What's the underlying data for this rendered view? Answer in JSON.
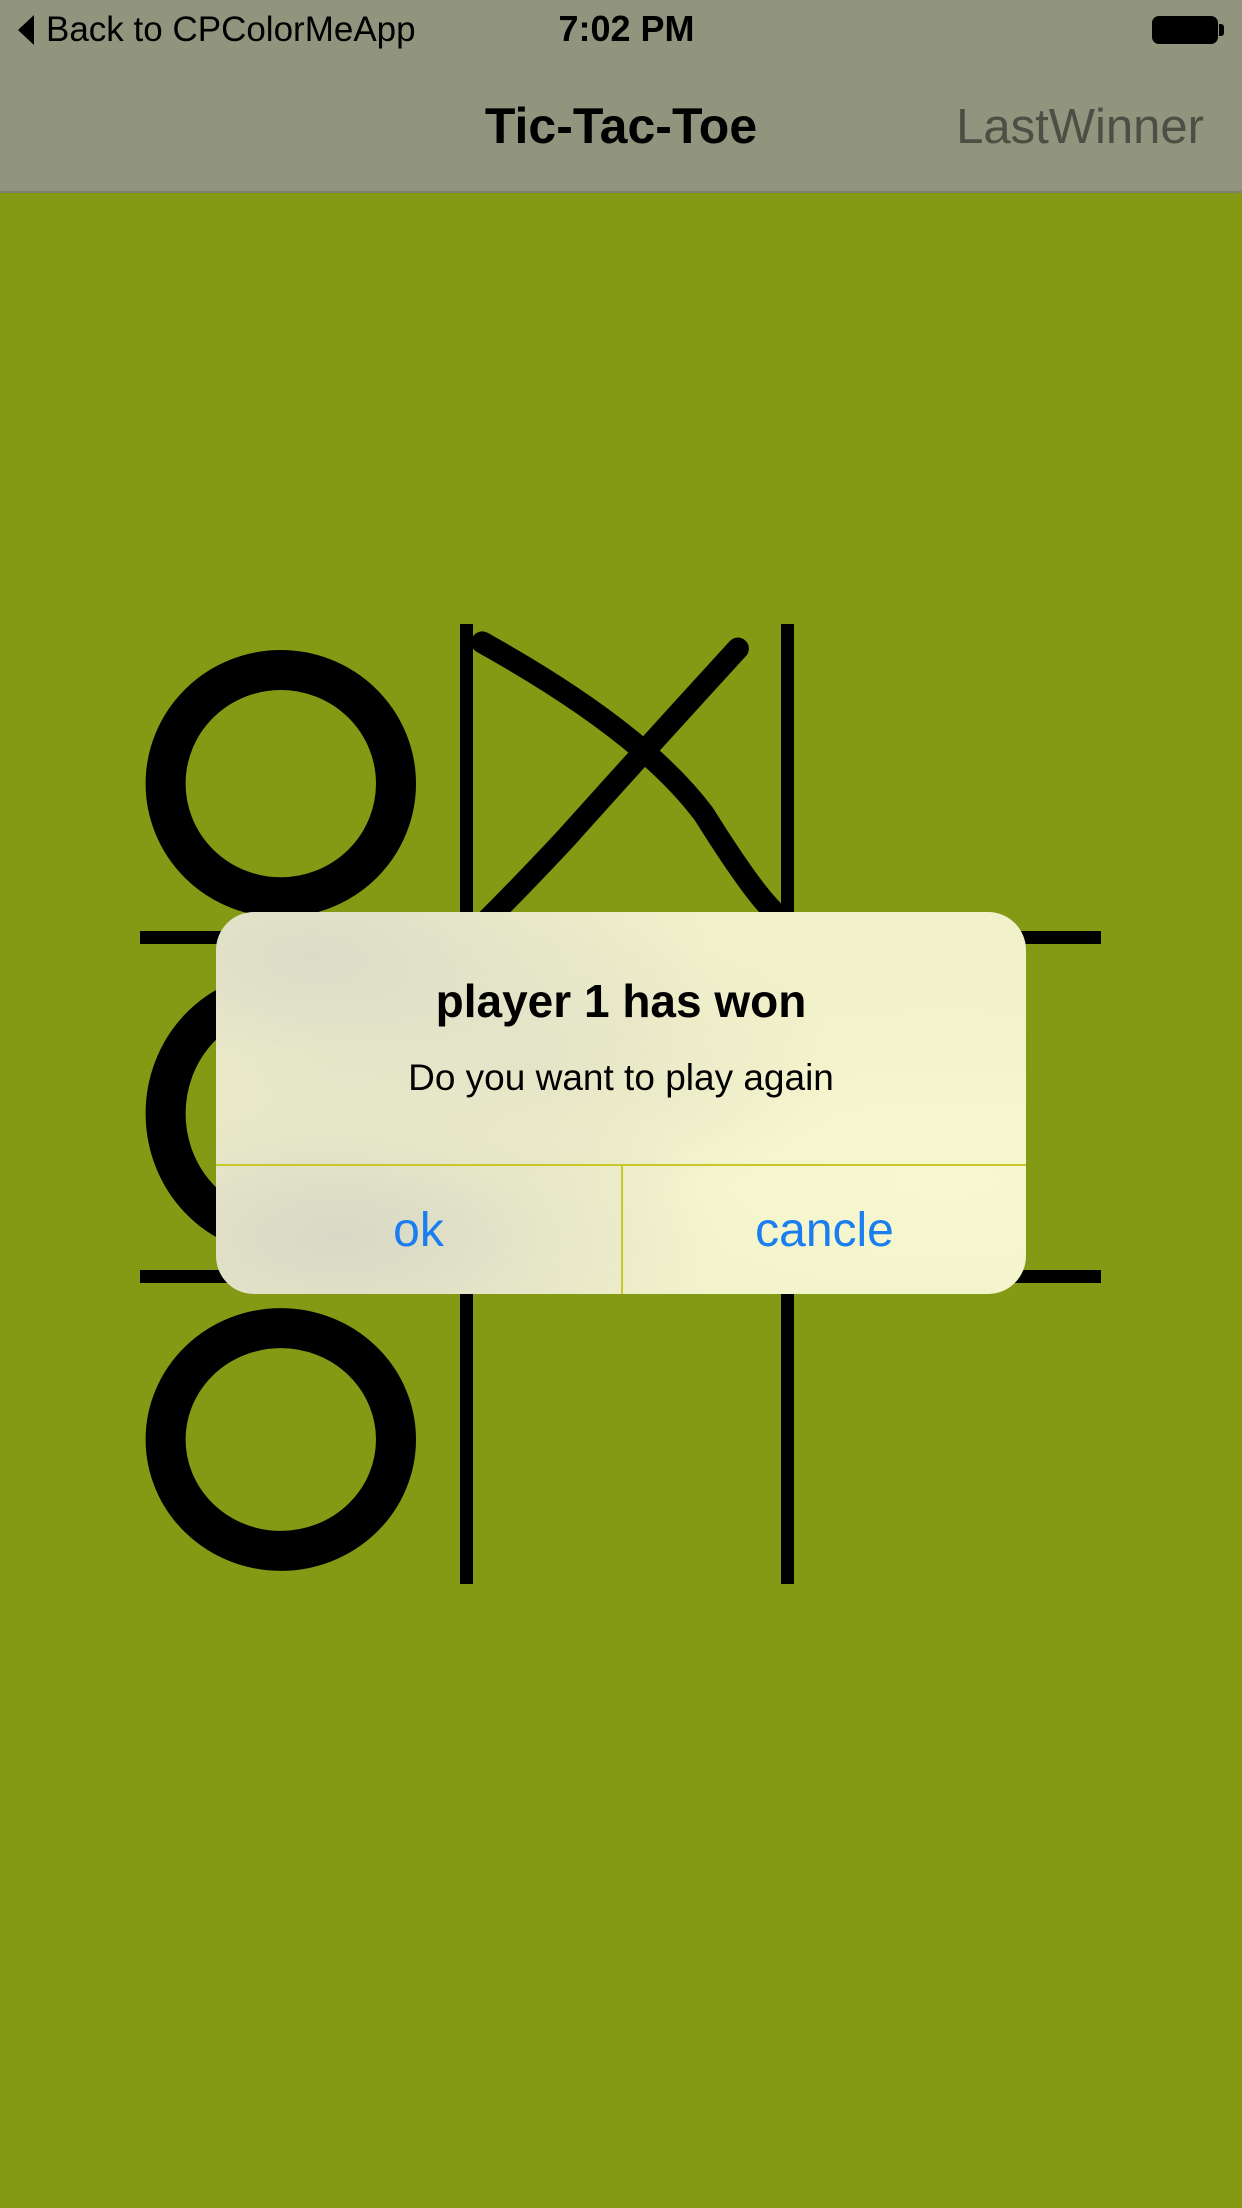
{
  "statusbar": {
    "back_label": "Back to CPColorMeApp",
    "time": "7:02 PM"
  },
  "navbar": {
    "title": "Tic-Tac-Toe",
    "right_button": "LastWinner"
  },
  "board": {
    "cells": [
      [
        "O",
        "X",
        ""
      ],
      [
        "O",
        "",
        ""
      ],
      [
        "O",
        "",
        ""
      ]
    ]
  },
  "alert": {
    "title": "player 1 has won",
    "message": "Do you want to play again",
    "ok_label": "ok",
    "cancel_label": "cancle"
  },
  "colors": {
    "background": "#849a14",
    "bar": "#92957d",
    "alert_button": "#1a7ef0",
    "divider": "#c7c92b"
  }
}
